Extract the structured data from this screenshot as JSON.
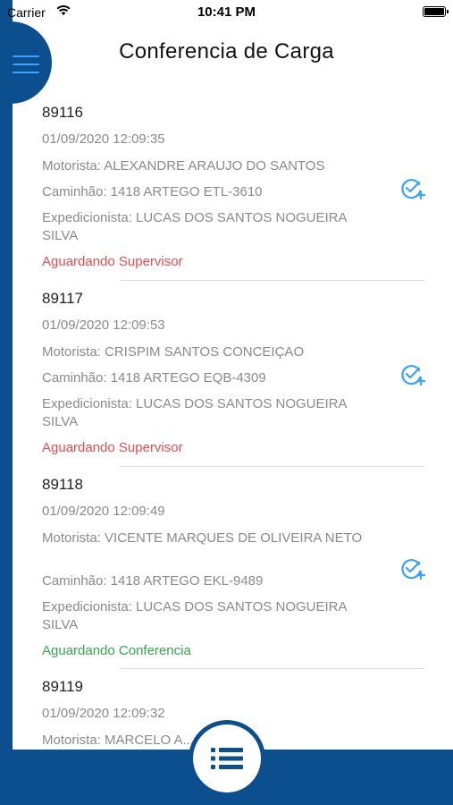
{
  "status_bar": {
    "carrier": "Carrier",
    "time": "10:41 PM"
  },
  "header": {
    "title": "Conferencia de Carga"
  },
  "colors": {
    "brand_blue": "#0b4f8e",
    "icon_blue": "#3aa3ff",
    "status_waiting_supervisor": "#e84b4b",
    "status_waiting_conference": "#33a84a"
  },
  "items": [
    {
      "code": "89116",
      "datetime": "01/09/2020 12:09:35",
      "driver": "Motorista: ALEXANDRE ARAUJO DO SANTOS",
      "truck": "Caminhão: 1418 ARTEGO ETL-3610",
      "dispatcher": "Expedicionista: LUCAS DOS SANTOS NOGUEIRA SILVA",
      "status": "Aguardando Supervisor",
      "action_icon": "check-plus-icon"
    },
    {
      "code": "89117",
      "datetime": "01/09/2020 12:09:53",
      "driver": "Motorista: CRISPIM SANTOS CONCEIÇAO",
      "truck": "Caminhão: 1418 ARTEGO EQB-4309",
      "dispatcher": "Expedicionista: LUCAS DOS SANTOS NOGUEIRA SILVA",
      "status": "Aguardando Supervisor",
      "action_icon": "check-plus-icon"
    },
    {
      "code": "89118",
      "datetime": "01/09/2020 12:09:49",
      "driver": "Motorista: VICENTE MARQUES DE OLIVEIRA NETO",
      "truck": "Caminhão: 1418 ARTEGO EKL-9489",
      "dispatcher": "Expedicionista: LUCAS DOS SANTOS NOGUEIRA SILVA",
      "status": "Aguardando Conferencia",
      "action_icon": "check-plus-icon"
    },
    {
      "code": "89119",
      "datetime": "01/09/2020 12:09:32",
      "driver": "Motorista: MARCELO A... GOMES"
    }
  ],
  "bottom_nav": {
    "center_icon": "list-icon"
  }
}
